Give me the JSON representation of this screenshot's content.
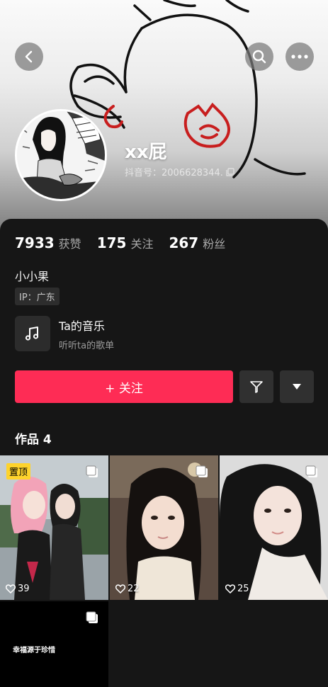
{
  "profile": {
    "nickname": "xx屁",
    "douyin_id": "抖音号：2006628344."
  },
  "stats": [
    {
      "value": "7933",
      "label": "获赞"
    },
    {
      "value": "175",
      "label": "关注"
    },
    {
      "value": "267",
      "label": "粉丝"
    }
  ],
  "bio": "小小果",
  "ip": "IP：广东",
  "music": {
    "title": "Ta的音乐",
    "subtitle": "听听ta的歌单",
    "icon": "music-note-icon"
  },
  "actions": {
    "follow_label": "+ 关注",
    "icons": [
      "back-arrow-icon",
      "search-icon",
      "more-icon",
      "filter-icon",
      "dropdown-triangle-icon"
    ]
  },
  "works": {
    "title": "作品 4",
    "pin_label": "置顶",
    "items": [
      {
        "likes": "39",
        "pinned": true
      },
      {
        "likes": "22",
        "pinned": false
      },
      {
        "likes": "25",
        "pinned": false
      },
      {
        "caption": "幸福源于珍惜"
      }
    ]
  },
  "colors": {
    "accent": "#fe2c55",
    "background": "#161616",
    "pin_badge": "#fed32c"
  }
}
